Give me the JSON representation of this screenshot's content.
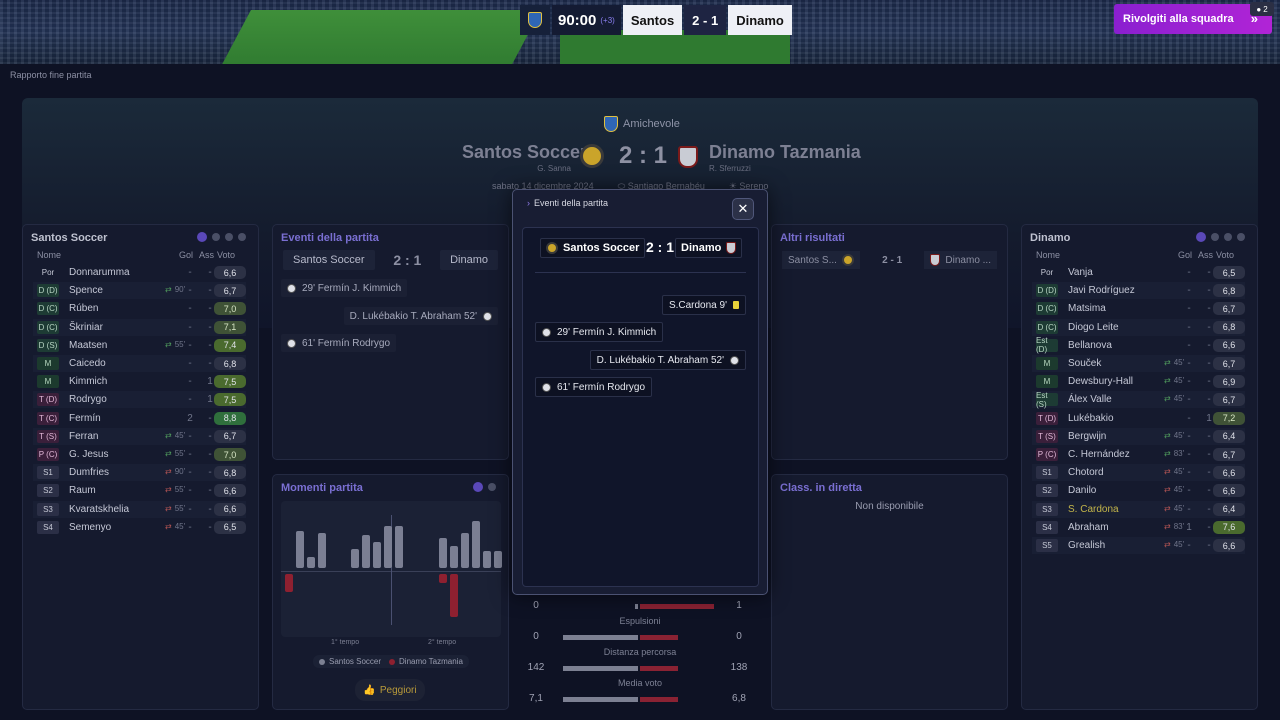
{
  "header": {
    "match_time": "90:00",
    "added_time": "(+3)",
    "home_short": "Santos",
    "score": "2 - 1",
    "away_short": "Dinamo",
    "rejoin_label": "Rivolgiti alla squadra",
    "notif_count": "2"
  },
  "breadcrumb": "Rapporto fine partita",
  "hero": {
    "competition": "Amichevole",
    "home_name": "Santos Soccer",
    "home_coach": "G. Sanna",
    "score": "2 : 1",
    "away_name": "Dinamo Tazmania",
    "away_coach": "R. Sferruzzi",
    "date": "sabato 14 dicembre 2024",
    "stadium": "Santiago Bernabéu",
    "weather": "Sereno"
  },
  "home_panel": {
    "title": "Santos Soccer",
    "cols": {
      "name": "Nome",
      "goals": "Gol",
      "assists": "Ass",
      "rating": "Voto"
    },
    "players": [
      {
        "pos": "Por",
        "name": "Donnarumma",
        "sub": "",
        "g": "-",
        "a": "-",
        "r": "6,6"
      },
      {
        "pos": "D (D)",
        "name": "Spence",
        "sub": "90'",
        "g": "-",
        "a": "-",
        "r": "6,7"
      },
      {
        "pos": "D (C)",
        "name": "Rúben",
        "sub": "",
        "g": "-",
        "a": "-",
        "r": "7,0"
      },
      {
        "pos": "D (C)",
        "name": "Škriniar",
        "sub": "",
        "g": "-",
        "a": "-",
        "r": "7,1"
      },
      {
        "pos": "D (S)",
        "name": "Maatsen",
        "sub": "55'",
        "g": "-",
        "a": "-",
        "r": "7,4"
      },
      {
        "pos": "M",
        "name": "Caicedo",
        "sub": "",
        "g": "-",
        "a": "-",
        "r": "6,8"
      },
      {
        "pos": "M",
        "name": "Kimmich",
        "sub": "",
        "g": "-",
        "a": "1",
        "r": "7,5"
      },
      {
        "pos": "T (D)",
        "name": "Rodrygo",
        "sub": "",
        "g": "-",
        "a": "1",
        "r": "7,5"
      },
      {
        "pos": "T (C)",
        "name": "Fermín",
        "sub": "",
        "g": "2",
        "a": "-",
        "r": "8,8"
      },
      {
        "pos": "T (S)",
        "name": "Ferran",
        "sub": "45'",
        "g": "-",
        "a": "-",
        "r": "6,7"
      },
      {
        "pos": "P (C)",
        "name": "G. Jesus",
        "sub": "55'",
        "g": "-",
        "a": "-",
        "r": "7,0"
      },
      {
        "pos": "S1",
        "name": "Dumfries",
        "sub": "90'",
        "g": "-",
        "a": "-",
        "r": "6,8"
      },
      {
        "pos": "S2",
        "name": "Raum",
        "sub": "55'",
        "g": "-",
        "a": "-",
        "r": "6,6"
      },
      {
        "pos": "S3",
        "name": "Kvaratskhelia",
        "sub": "55'",
        "g": "-",
        "a": "-",
        "r": "6,6"
      },
      {
        "pos": "S4",
        "name": "Semenyo",
        "sub": "45'",
        "g": "-",
        "a": "-",
        "r": "6,5"
      }
    ]
  },
  "away_panel": {
    "title": "Dinamo",
    "cols": {
      "name": "Nome",
      "goals": "Gol",
      "assists": "Ass",
      "rating": "Voto"
    },
    "players": [
      {
        "pos": "Por",
        "name": "Vanja",
        "sub": "",
        "g": "-",
        "a": "-",
        "r": "6,5"
      },
      {
        "pos": "D (D)",
        "name": "Javi Rodríguez",
        "sub": "",
        "g": "-",
        "a": "-",
        "r": "6,8"
      },
      {
        "pos": "D (C)",
        "name": "Matsima",
        "sub": "",
        "g": "-",
        "a": "-",
        "r": "6,7"
      },
      {
        "pos": "D (C)",
        "name": "Diogo Leite",
        "sub": "",
        "g": "-",
        "a": "-",
        "r": "6,8"
      },
      {
        "pos": "Est (D)",
        "name": "Bellanova",
        "sub": "",
        "g": "-",
        "a": "-",
        "r": "6,6"
      },
      {
        "pos": "M",
        "name": "Souček",
        "sub": "45'",
        "g": "-",
        "a": "-",
        "r": "6,7"
      },
      {
        "pos": "M",
        "name": "Dewsbury-Hall",
        "sub": "45'",
        "g": "-",
        "a": "-",
        "r": "6,9"
      },
      {
        "pos": "Est (S)",
        "name": "Álex Valle",
        "sub": "45'",
        "g": "-",
        "a": "-",
        "r": "6,7"
      },
      {
        "pos": "T (D)",
        "name": "Lukébakio",
        "sub": "",
        "g": "-",
        "a": "1",
        "r": "7,2"
      },
      {
        "pos": "T (S)",
        "name": "Bergwijn",
        "sub": "45'",
        "g": "-",
        "a": "-",
        "r": "6,4"
      },
      {
        "pos": "P (C)",
        "name": "C. Hernández",
        "sub": "83'",
        "g": "-",
        "a": "-",
        "r": "6,7"
      },
      {
        "pos": "S1",
        "name": "Chotord",
        "sub": "45'",
        "g": "-",
        "a": "-",
        "r": "6,6"
      },
      {
        "pos": "S2",
        "name": "Danilo",
        "sub": "45'",
        "g": "-",
        "a": "-",
        "r": "6,6"
      },
      {
        "pos": "S3",
        "name": "S. Cardona",
        "sub": "45'",
        "g": "-",
        "a": "-",
        "r": "6,4"
      },
      {
        "pos": "S4",
        "name": "Abraham",
        "sub": "83'",
        "g": "1",
        "a": "-",
        "r": "7,6"
      },
      {
        "pos": "S5",
        "name": "Grealish",
        "sub": "45'",
        "g": "-",
        "a": "-",
        "r": "6,6"
      }
    ]
  },
  "events_panel": {
    "title": "Eventi della partita",
    "home": "Santos Soccer",
    "score": "2 : 1",
    "away": "Dinamo",
    "events": [
      {
        "text": "29'  Fermín  J. Kimmich"
      },
      {
        "text": "D. Lukébakio  T. Abraham  52'"
      },
      {
        "text": "61'  Fermín  Rodrygo"
      }
    ]
  },
  "moments_panel": {
    "title": "Momenti partita",
    "half1": "1° tempo",
    "half2": "2° tempo",
    "legend_home": "Santos Soccer",
    "legend_away": "Dinamo Tazmania",
    "button": "Peggiori",
    "home_bars": [
      0.0,
      0.62,
      0.18,
      0.58,
      0.0,
      0.0,
      0.31,
      0.55,
      0.43,
      0.7,
      0.7,
      0.0,
      0.0,
      0.0,
      0.5,
      0.36,
      0.58,
      0.78,
      0.28,
      0.28
    ],
    "away_bars": [
      0.3,
      0,
      0,
      0,
      0,
      0,
      0,
      0,
      0,
      0,
      0,
      0,
      0,
      0,
      0.15,
      0.72,
      0,
      0,
      0,
      0
    ]
  },
  "other_results": {
    "title": "Altri risultati",
    "home": "Santos S...",
    "score": "2 - 1",
    "away": "Dinamo ..."
  },
  "live_table": {
    "title": "Class. in diretta",
    "empty": "Non disponibile"
  },
  "stats": [
    {
      "label": "",
      "home": "0",
      "away": "1",
      "home_share": 0.02,
      "away_share": 0.98
    },
    {
      "label": "Espulsioni",
      "home": "0",
      "away": "0",
      "home_share": 0.5,
      "away_share": 0.5
    },
    {
      "label": "Distanza percorsa",
      "home": "142",
      "away": "138",
      "home_share": 0.5,
      "away_share": 0.5
    },
    {
      "label": "Media voto",
      "home": "7,1",
      "away": "6,8",
      "home_share": 0.5,
      "away_share": 0.5
    }
  ],
  "modal": {
    "title": "Eventi della partita",
    "home": "Santos Soccer",
    "score": "2 : 1",
    "away": "Dinamo",
    "card_event": "S.Cardona  9'",
    "goal1": "29'  Fermín  J. Kimmich",
    "goal2": "D. Lukébakio  T. Abraham  52'",
    "goal3": "61'  Fermín  Rodrygo"
  },
  "colors": {
    "accent": "#5a48b8",
    "home": "#7c8092",
    "away": "#8e2030",
    "rejoin": "#b124d6"
  }
}
